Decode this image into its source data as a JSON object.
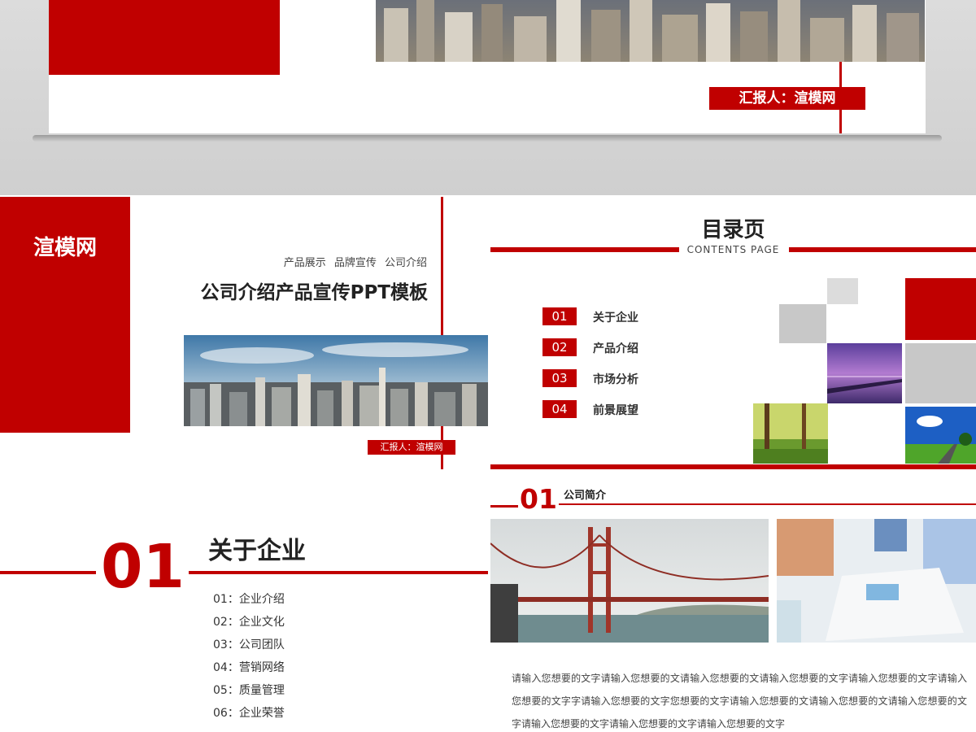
{
  "hero": {
    "reporter": "汇报人：渲模网"
  },
  "cover": {
    "brand": "渲模网",
    "subtitle": "产品展示   品牌宣传   公司介绍",
    "title": "公司介绍产品宣传PPT模板",
    "reporter": "汇报人：渲模网"
  },
  "contents": {
    "title": "目录页",
    "subtitle": "CONTENTS   PAGE",
    "items": [
      {
        "num": "01",
        "label": "关于企业"
      },
      {
        "num": "02",
        "label": "产品介绍"
      },
      {
        "num": "03",
        "label": "市场分析"
      },
      {
        "num": "04",
        "label": "前景展望"
      }
    ]
  },
  "section": {
    "num": "01",
    "title": "关于企业",
    "items": [
      "01：企业介绍",
      "02：企业文化",
      "03：公司团队",
      "04：营销网络",
      "05：质量管理",
      "06：企业荣誉"
    ]
  },
  "intro": {
    "num": "01",
    "title": "公司简介",
    "body": "请输入您想要的文字请输入您想要的文请输入您想要的文请输入您想要的文字请输入您想要的文字请输入您想要的文字字请输入您想要的文字您想要的文字请输入您想要的文请输入您想要的文请输入您想要的文字请输入您想要的文字请输入您想要的文字请输入您想要的文字"
  },
  "colors": {
    "accent": "#c00000",
    "text": "#222222"
  }
}
